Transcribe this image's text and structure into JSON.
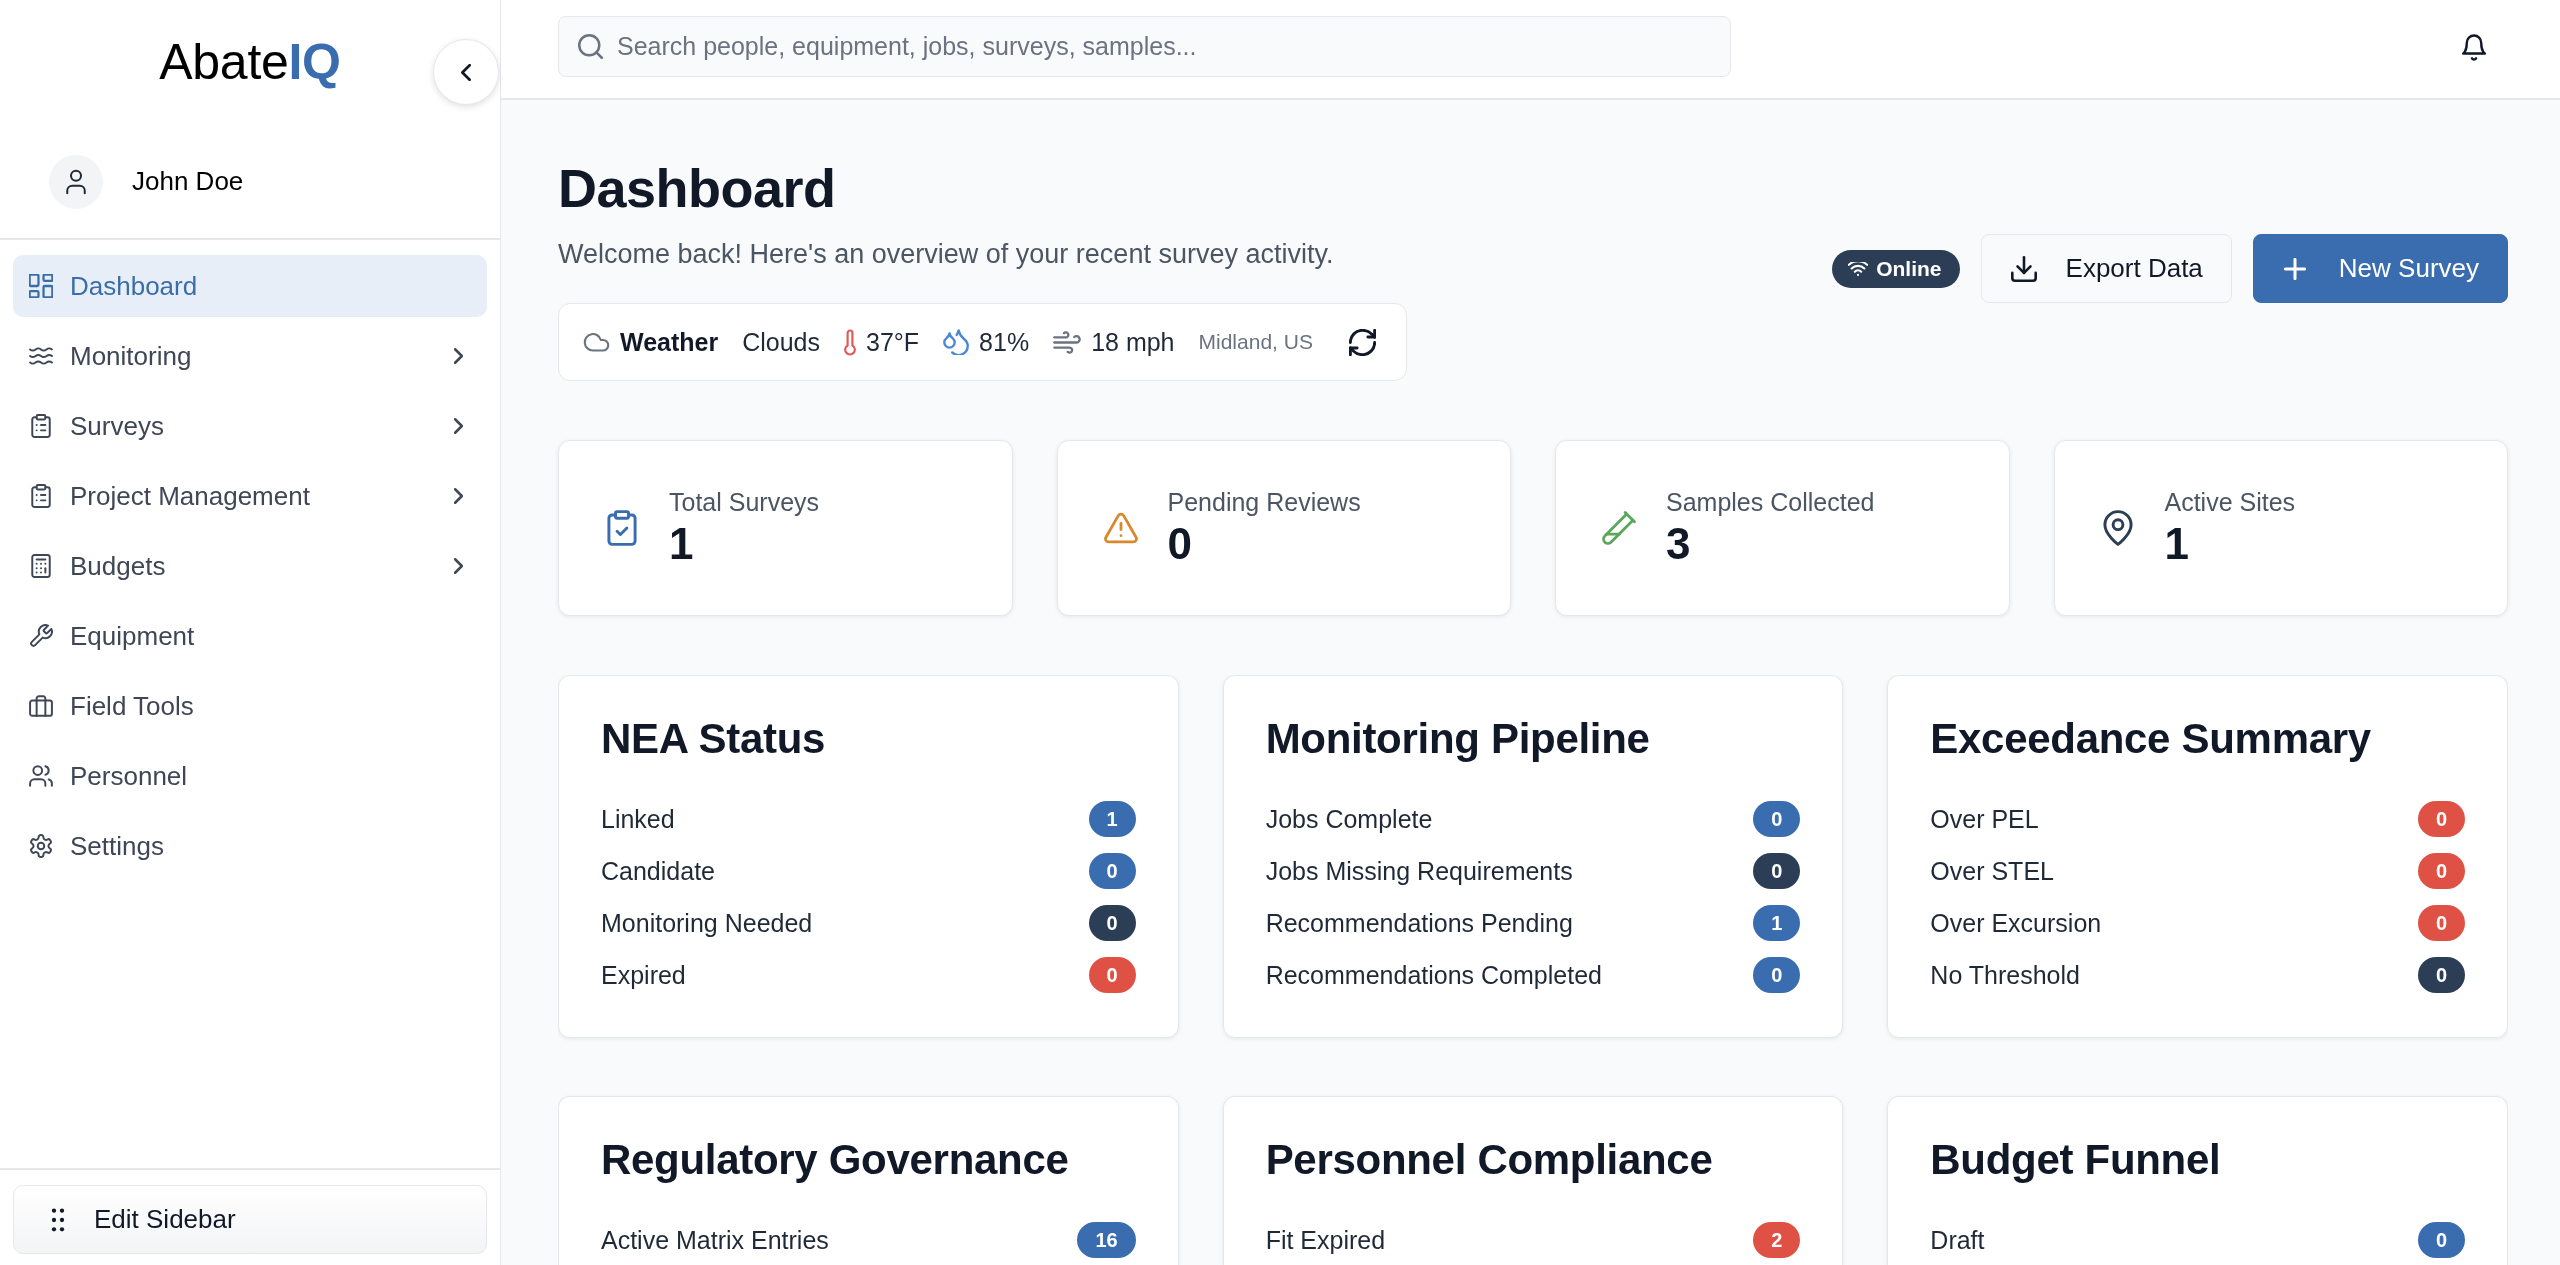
{
  "sidebar": {
    "logo": {
      "name": "Abate",
      "highlight": "IQ"
    },
    "user": {
      "name": "John Doe"
    },
    "items": [
      {
        "label": "Dashboard",
        "selected": true,
        "expandable": false
      },
      {
        "label": "Monitoring",
        "selected": false,
        "expandable": true
      },
      {
        "label": "Surveys",
        "selected": false,
        "expandable": true
      },
      {
        "label": "Project Management",
        "selected": false,
        "expandable": true
      },
      {
        "label": "Budgets",
        "selected": false,
        "expandable": true
      },
      {
        "label": "Equipment",
        "selected": false,
        "expandable": false
      },
      {
        "label": "Field Tools",
        "selected": false,
        "expandable": false
      },
      {
        "label": "Personnel",
        "selected": false,
        "expandable": false
      },
      {
        "label": "Settings",
        "selected": false,
        "expandable": false
      }
    ],
    "edit_button": {
      "label": "Edit Sidebar"
    }
  },
  "header": {
    "search": {
      "placeholder": "Search people, equipment, jobs, surveys, samples..."
    }
  },
  "page": {
    "title": "Dashboard",
    "subtitle": "Welcome back! Here's an overview of your recent survey activity.",
    "weather": {
      "label": "Weather",
      "condition": "Clouds",
      "temperature": "37°F",
      "humidity": "81%",
      "wind": "18 mph",
      "location": "Midland, US"
    },
    "status": "Online",
    "actions": [
      {
        "label": "Export Data",
        "kind": "secondary"
      },
      {
        "label": "New Survey",
        "kind": "primary"
      }
    ]
  },
  "stats": [
    {
      "label": "Total Surveys",
      "value": "1",
      "color": "#3a6daf"
    },
    {
      "label": "Pending Reviews",
      "value": "0",
      "color": "#d9892b"
    },
    {
      "label": "Samples Collected",
      "value": "3",
      "color": "#5aa65a"
    },
    {
      "label": "Active Sites",
      "value": "1",
      "color": "#2c3e55"
    }
  ],
  "cards": [
    {
      "title": "NEA Status",
      "rows": [
        {
          "label": "Linked",
          "count": "1",
          "color": "#3a6daf"
        },
        {
          "label": "Candidate",
          "count": "0",
          "color": "#3a6daf"
        },
        {
          "label": "Monitoring Needed",
          "count": "0",
          "color": "#2c3e55"
        },
        {
          "label": "Expired",
          "count": "0",
          "color": "#df5144"
        }
      ]
    },
    {
      "title": "Monitoring Pipeline",
      "rows": [
        {
          "label": "Jobs Complete",
          "count": "0",
          "color": "#3a6daf"
        },
        {
          "label": "Jobs Missing Requirements",
          "count": "0",
          "color": "#2c3e55"
        },
        {
          "label": "Recommendations Pending",
          "count": "1",
          "color": "#3a6daf"
        },
        {
          "label": "Recommendations Completed",
          "count": "0",
          "color": "#3a6daf"
        }
      ]
    },
    {
      "title": "Exceedance Summary",
      "rows": [
        {
          "label": "Over PEL",
          "count": "0",
          "color": "#df5144"
        },
        {
          "label": "Over STEL",
          "count": "0",
          "color": "#df5144"
        },
        {
          "label": "Over Excursion",
          "count": "0",
          "color": "#df5144"
        },
        {
          "label": "No Threshold",
          "count": "0",
          "color": "#2c3e55"
        }
      ]
    },
    {
      "title": "Regulatory Governance",
      "rows": [
        {
          "label": "Active Matrix Entries",
          "count": "16",
          "color": "#3a6daf"
        }
      ]
    },
    {
      "title": "Personnel Compliance",
      "rows": [
        {
          "label": "Fit Expired",
          "count": "2",
          "color": "#df5144"
        }
      ]
    },
    {
      "title": "Budget Funnel",
      "rows": [
        {
          "label": "Draft",
          "count": "0",
          "color": "#3a6daf"
        }
      ]
    }
  ]
}
